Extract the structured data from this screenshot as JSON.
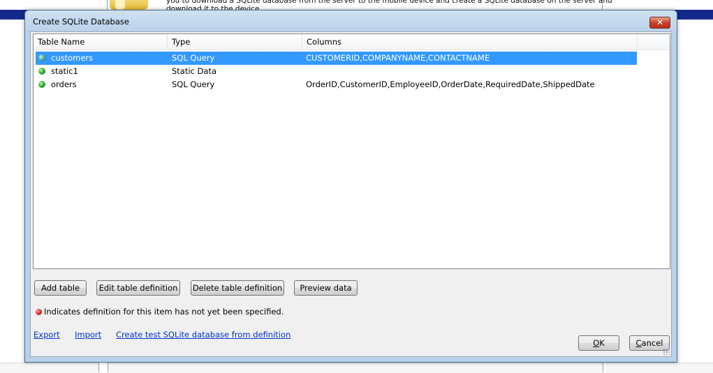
{
  "background": {
    "text_line_1": "you to download a SQLite database from the server to the mobile device and create a SQLite database on the server and",
    "text_line_2": "download it to the device."
  },
  "dialog": {
    "title": "Create SQLite Database",
    "close_label": "✕"
  },
  "table": {
    "headers": [
      "Table Name",
      "Type",
      "Columns"
    ],
    "rows": [
      {
        "name": "customers",
        "type": "SQL Query",
        "columns": "CUSTOMERID,COMPANYNAME,CONTACTNAME",
        "selected": true
      },
      {
        "name": "static1",
        "type": "Static Data",
        "columns": "",
        "selected": false
      },
      {
        "name": "orders",
        "type": "SQL Query",
        "columns": "OrderID,CustomerID,EmployeeID,OrderDate,RequiredDate,ShippedDate",
        "selected": false
      }
    ]
  },
  "buttons": {
    "add": "Add table",
    "edit": "Edit table definition",
    "delete": "Delete table definition",
    "preview": "Preview data",
    "ok_underlined": "O",
    "ok_rest": "K",
    "cancel_underlined": "C",
    "cancel_rest": "ancel"
  },
  "legend": {
    "text": "Indicates definition for this item has not yet been specified."
  },
  "links": {
    "export": "Export",
    "import": "Import",
    "create_test": "Create test SQLite database from definition"
  },
  "colors": {
    "selection": "#3399ff",
    "link": "#0033cc",
    "title_bar": "#b9d1ea",
    "background_bar": "#132a8c"
  }
}
